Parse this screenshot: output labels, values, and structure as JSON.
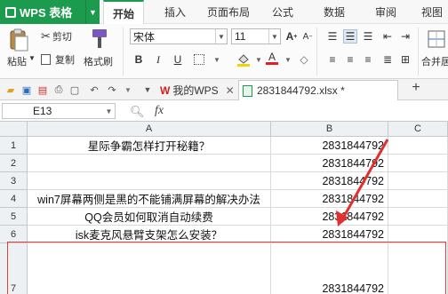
{
  "app": {
    "name": "WPS 表格"
  },
  "menu": {
    "tabs": [
      "开始",
      "插入",
      "页面布局",
      "公式",
      "数据",
      "审阅",
      "视图"
    ],
    "active": "开始"
  },
  "ribbon": {
    "cut": "剪切",
    "copy": "复制",
    "paste": "粘贴",
    "format_painter": "格式刷",
    "font_name": "宋体",
    "font_size": "11",
    "merge_center": "合并居中",
    "bold": "B",
    "italic": "I",
    "underline": "U",
    "font_color_letter": "A",
    "grow_font": "A",
    "shrink_font": "A"
  },
  "doc_tabs": {
    "home_tab": "我的WPS",
    "file_tab": "2831844792.xlsx *"
  },
  "formula_bar": {
    "name_box": "E13",
    "fx": "fx",
    "value": ""
  },
  "columns": [
    "A",
    "B",
    "C"
  ],
  "rows": [
    {
      "num": "1",
      "a": "星际争霸怎样打开秘籍？",
      "b": "2831844792"
    },
    {
      "num": "2",
      "a": "",
      "b": "2831844792"
    },
    {
      "num": "3",
      "a": "",
      "b": "2831844792"
    },
    {
      "num": "4",
      "a": "win7屏幕两侧是黑的不能铺满屏幕的解决办法",
      "b": "2831844792"
    },
    {
      "num": "5",
      "a": "QQ会员如何取消自动续费",
      "b": "2831844792"
    },
    {
      "num": "6",
      "a": "isk麦克风悬臂支架怎么安装？",
      "b": "2831844792"
    },
    {
      "num": "7",
      "a": "",
      "b": "2831844792"
    }
  ],
  "colors": {
    "brand": "#1c9b4f",
    "highlight": "#e04040"
  }
}
